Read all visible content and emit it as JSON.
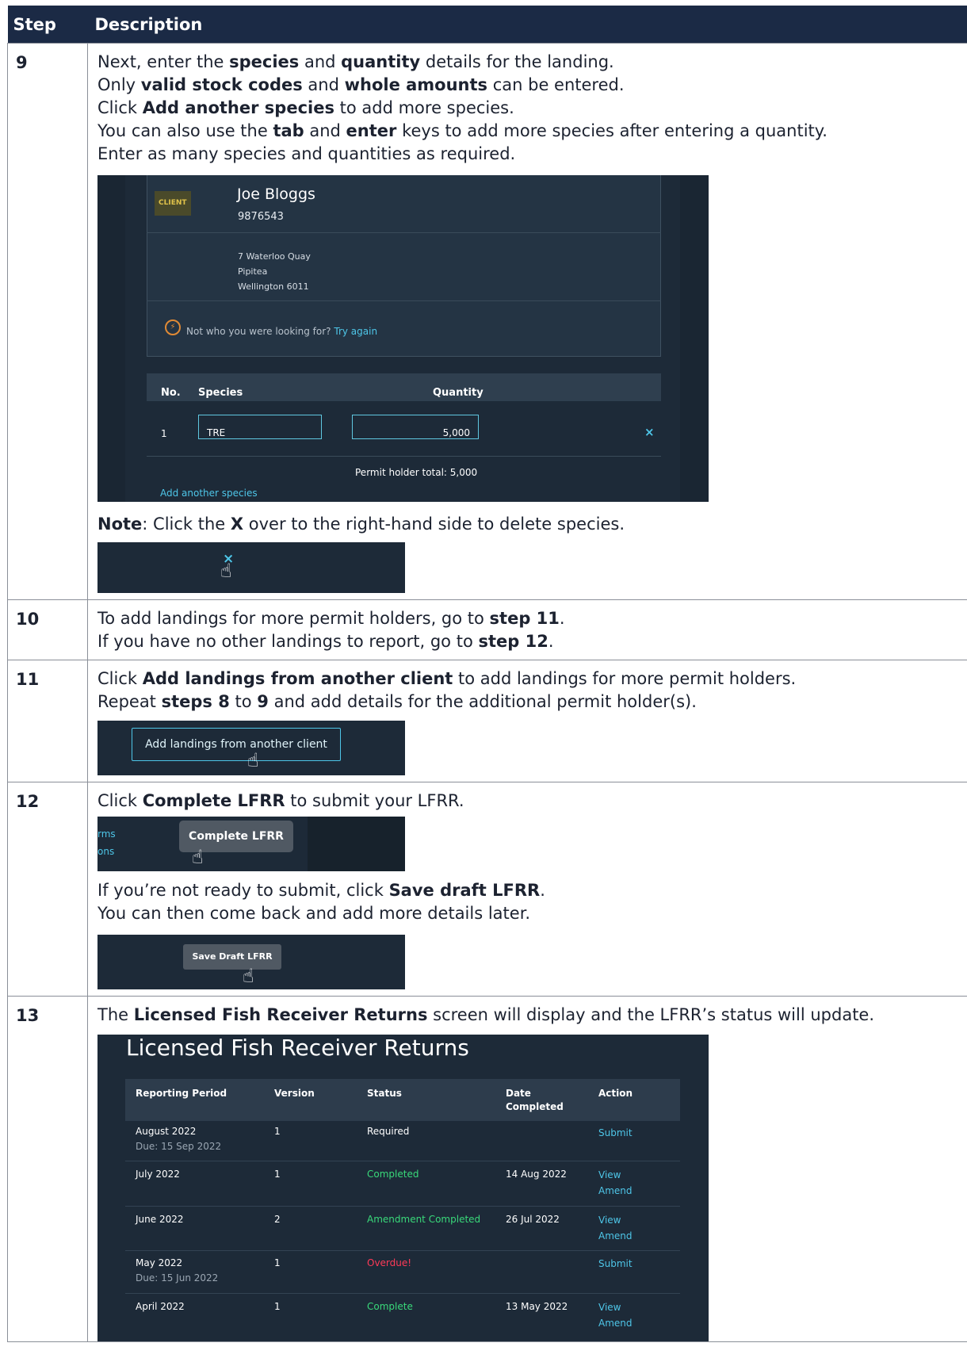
{
  "header": {
    "step": "Step",
    "description": "Description"
  },
  "s9": {
    "no": "9",
    "l1a": "Next, enter the ",
    "l1b": "species",
    "l1c": " and ",
    "l1d": "quantity",
    "l1e": " details for the landing.",
    "l2a": "Only ",
    "l2b": "valid stock codes",
    "l2c": " and ",
    "l2d": "whole amounts",
    "l2e": " can be entered.",
    "l3a": "Click ",
    "l3b": "Add another species",
    "l3c": " to add more species.",
    "l4a": "You can also use the ",
    "l4b": "tab",
    "l4c": " and ",
    "l4d": "enter",
    "l4e": " keys to add more species after entering a quantity.",
    "l5": "Enter as many species and quantities as required.",
    "shot": {
      "badge": "CLIENT",
      "name": "Joe Bloggs",
      "number": "9876543",
      "addr1": "7 Waterloo Quay",
      "addr2": "Pipitea",
      "addr3": "Wellington 6011",
      "warn": "Not who you were looking for?",
      "try_again": "Try again",
      "col_no": "No.",
      "col_species": "Species",
      "col_quantity": "Quantity",
      "row_no": "1",
      "species_value": "TRE",
      "quantity_value": "5,000",
      "delete": "×",
      "total": "Permit holder total: 5,000",
      "add_species": "Add another species"
    },
    "note_a": "Note",
    "note_b": ": Click the ",
    "note_c": "X",
    "note_d": " over to the right-hand side to delete species.",
    "mini_x": "×"
  },
  "s10": {
    "no": "10",
    "l1a": "To add landings for more permit holders, go to ",
    "l1b": "step 11",
    "l1c": ".",
    "l2a": "If you have no other landings to report, go to ",
    "l2b": "step 12",
    "l2c": "."
  },
  "s11": {
    "no": "11",
    "l1a": "Click ",
    "l1b": "Add landings from another client",
    "l1c": " to add landings for more permit holders.",
    "l2a": "Repeat ",
    "l2b": "steps 8",
    "l2c": " to ",
    "l2d": "9",
    "l2e": " and add details for the additional permit holder(s).",
    "button": "Add landings from another client"
  },
  "s12": {
    "no": "12",
    "l1a": "Click ",
    "l1b": "Complete LFRR",
    "l1c": " to submit your LFRR.",
    "side1": "rms",
    "side2": "ons",
    "complete_button": "Complete LFRR",
    "l2a": "If you’re not ready to submit, click ",
    "l2b": "Save draft LFRR",
    "l2c": ".",
    "l3": "You can then come back and add more details later.",
    "save_button": "Save Draft LFRR"
  },
  "s13": {
    "no": "13",
    "l1a": "The ",
    "l1b": "Licensed Fish Receiver Returns",
    "l1c": " screen will display and the LFRR’s status will update.",
    "title": "Licensed Fish Receiver Returns",
    "cols": [
      "Reporting Period",
      "Version",
      "Status",
      "Date",
      "Completed",
      "Action"
    ],
    "rows": [
      {
        "period": "August 2022",
        "due": "Due: 15 Sep 2022",
        "version": "1",
        "status": "Required",
        "date": "",
        "a1": "Submit",
        "a2": ""
      },
      {
        "period": "July 2022",
        "due": "",
        "version": "1",
        "status": "Completed",
        "date": "14 Aug 2022",
        "a1": "View",
        "a2": "Amend"
      },
      {
        "period": "June 2022",
        "due": "",
        "version": "2",
        "status": "Amendment Completed",
        "date": "26 Jul 2022",
        "a1": "View",
        "a2": "Amend"
      },
      {
        "period": "May 2022",
        "due": "Due: 15 Jun 2022",
        "version": "1",
        "status": "Overdue!",
        "date": "",
        "a1": "Submit",
        "a2": ""
      },
      {
        "period": "April 2022",
        "due": "",
        "version": "1",
        "status": "Complete",
        "date": "13 May 2022",
        "a1": "View",
        "a2": "Amend"
      }
    ]
  },
  "cursor_glyph": "☝"
}
